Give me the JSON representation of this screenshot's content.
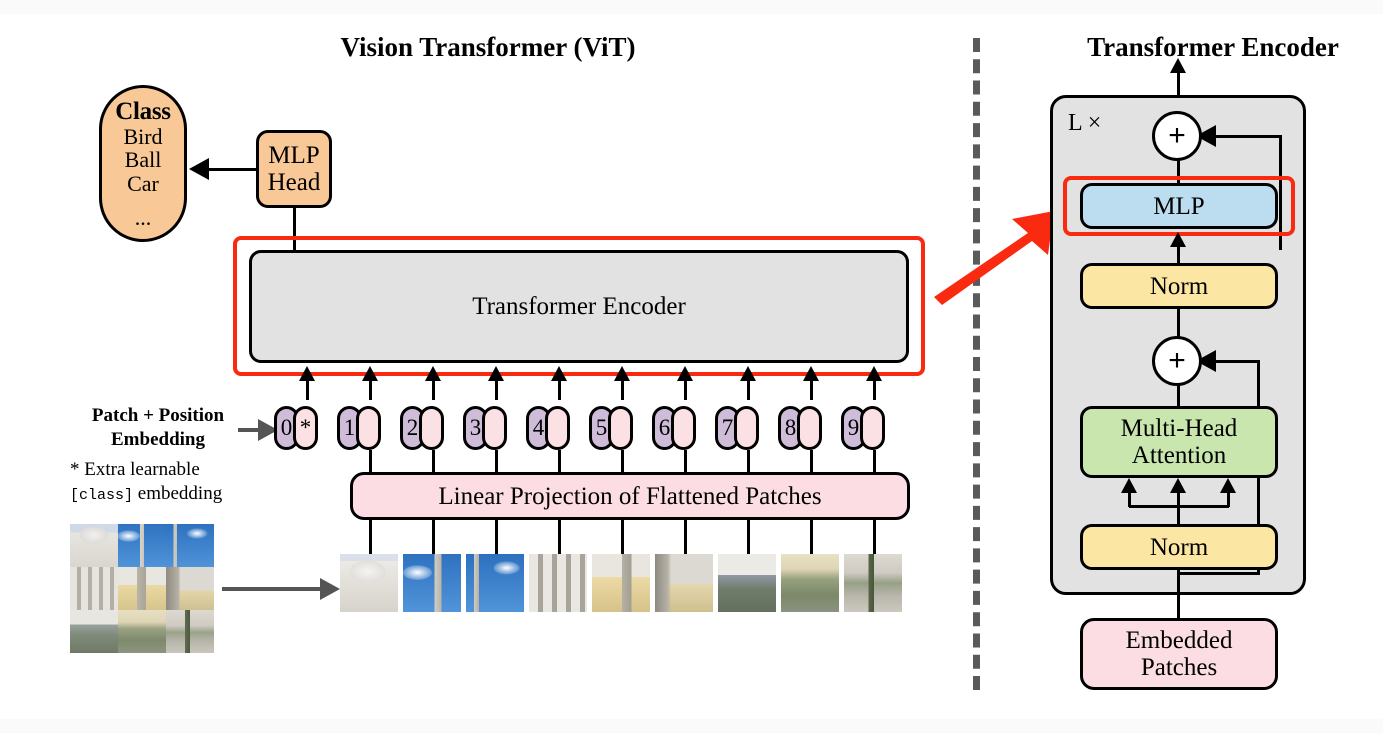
{
  "figure": {
    "left_panel_title": "Vision Transformer (ViT)",
    "right_panel_title": "Transformer Encoder"
  },
  "colors": {
    "orange": "#f8c896",
    "pink": "#fbdde3",
    "pink_token": "#fbe0e4",
    "purple_token": "#cfbcd9",
    "gray_panel": "#e2e2e2",
    "blue_mlp": "#bcdcef",
    "yellow_norm": "#fbe6a4",
    "green_attention": "#c8e6ad",
    "red_highlight": "#fa2a11",
    "divider_gray": "#5a5a5a",
    "outline_black": "#000000"
  },
  "left": {
    "class_box": {
      "heading": "Class",
      "items": [
        "Bird",
        "Ball",
        "Car"
      ],
      "ellipsis": "..."
    },
    "mlp_head": {
      "line1": "MLP",
      "line2": "Head"
    },
    "encoder_box": {
      "label": "Transformer Encoder"
    },
    "embedding_label": {
      "line1": "Patch + Position",
      "line2": "Embedding"
    },
    "footnote": {
      "line1_prefix": "* Extra learnable",
      "token": "[class]",
      "line2_suffix": " embedding"
    },
    "linear_projection": {
      "label": "Linear Projection of Flattened Patches"
    },
    "tokens": [
      {
        "position": "0",
        "extra": "*"
      },
      {
        "position": "1",
        "extra": ""
      },
      {
        "position": "2",
        "extra": ""
      },
      {
        "position": "3",
        "extra": ""
      },
      {
        "position": "4",
        "extra": ""
      },
      {
        "position": "5",
        "extra": ""
      },
      {
        "position": "6",
        "extra": ""
      },
      {
        "position": "7",
        "extra": ""
      },
      {
        "position": "8",
        "extra": ""
      },
      {
        "position": "9",
        "extra": ""
      }
    ],
    "source_image": {
      "description": "3x3 grid of photo patches of a palace facade",
      "rows": 3,
      "cols": 3
    },
    "patch_strip": {
      "count": 9,
      "description": "row of 9 flattened image patches"
    }
  },
  "right": {
    "repeat_label": "L ×",
    "blocks": {
      "mlp": "MLP",
      "norm_top": "Norm",
      "attention": "Multi-Head\nAttention",
      "attention_line1": "Multi-Head",
      "attention_line2": "Attention",
      "norm_bottom": "Norm",
      "embedded_patches_line1": "Embedded",
      "embedded_patches_line2": "Patches"
    },
    "residual_adds": [
      "+",
      "+"
    ]
  }
}
